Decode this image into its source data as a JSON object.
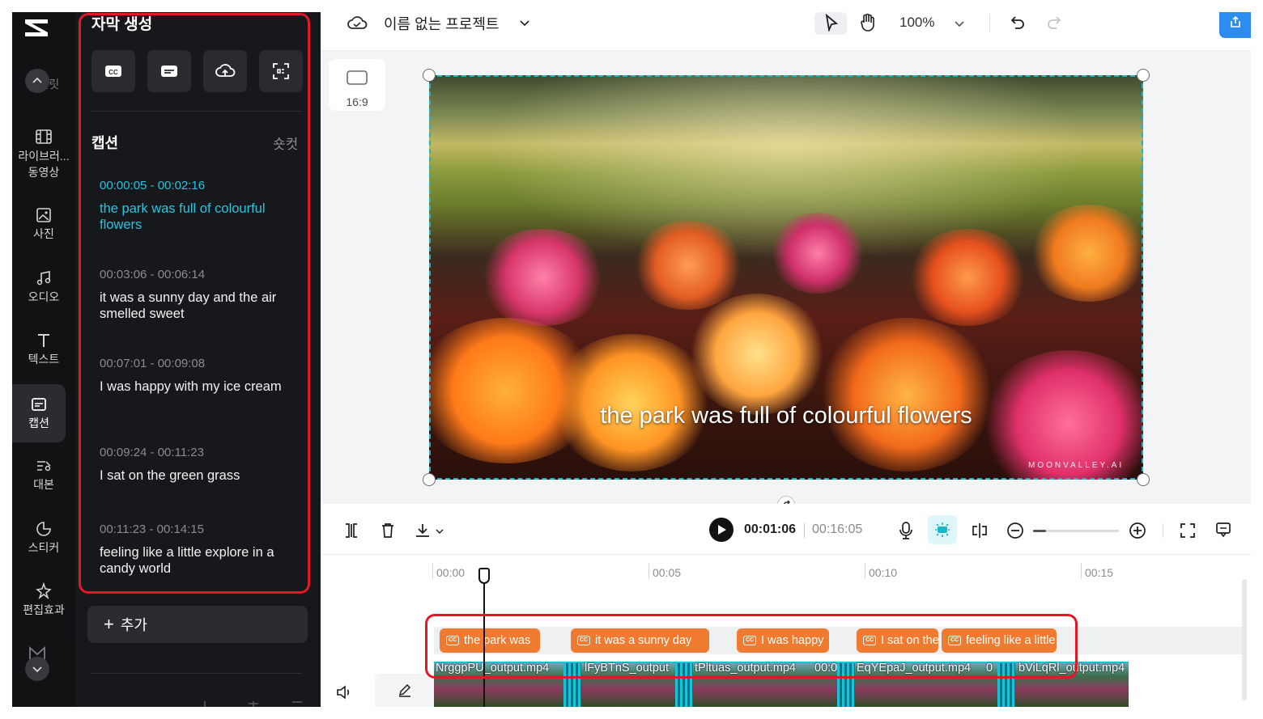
{
  "rail": {
    "items": [
      {
        "label": "템플릿",
        "icon": "template-icon"
      },
      {
        "label": "라이브러... 동영상",
        "icon": "film-icon"
      },
      {
        "label": "사진",
        "icon": "image-icon"
      },
      {
        "label": "오디오",
        "icon": "music-icon"
      },
      {
        "label": "텍스트",
        "icon": "text-icon"
      },
      {
        "label": "캡션",
        "icon": "caption-icon"
      },
      {
        "label": "대본",
        "icon": "script-icon"
      },
      {
        "label": "스티커",
        "icon": "sticker-icon"
      },
      {
        "label": "편집효과",
        "icon": "effects-icon"
      }
    ],
    "active": "캡션"
  },
  "panel": {
    "title": "자막 생성",
    "section_title": "캡션",
    "shortcut_label": "숏컷",
    "add_label": "추가",
    "captions": [
      {
        "time": "00:00:05 - 00:02:16",
        "text": "the park was full of colourful flowers",
        "active": true
      },
      {
        "time": "00:03:06 - 00:06:14",
        "text": "it was a sunny day and the air smelled sweet"
      },
      {
        "time": "00:07:01 - 00:09:08",
        "text": "I was happy with my ice cream"
      },
      {
        "time": "00:09:24 - 00:11:23",
        "text": "I sat on the green grass"
      },
      {
        "time": "00:11:23 - 00:14:15",
        "text": "feeling like a little explore in a candy world"
      }
    ]
  },
  "topbar": {
    "project_name": "이름 없는 프로젝트",
    "zoom": "100%"
  },
  "canvas": {
    "ratio_label": "16:9",
    "subtitle": "the park was full of colourful flowers",
    "watermark": "MOONVALLEY.AI"
  },
  "playback": {
    "current_time": "00:01:06",
    "total_time": "00:16:05"
  },
  "timeline": {
    "ticks": [
      "00:00",
      "00:05",
      "00:10",
      "00:15"
    ],
    "caption_clips": [
      "the park was",
      "it was a sunny day",
      "I was happy",
      "I sat on the",
      "feeling like a little"
    ],
    "video_clips": [
      "NrggpPU_output.mp4",
      "lFyBTnS_output",
      "tPltuas_output.mp4",
      "00:0",
      "EqYEpaJ_output.mp4",
      "0",
      "bViLqRl_output.mp4"
    ]
  },
  "colors": {
    "accent_cyan": "#22c6e0",
    "caption_clip": "#f07a2f",
    "highlight_red": "#e01828"
  }
}
